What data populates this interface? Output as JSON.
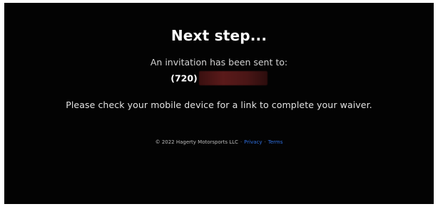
{
  "heading": "Next step...",
  "invite_text": "An invitation has been sent to:",
  "phone_prefix": "(720)",
  "instructions": "Please check your mobile device for a link to complete your waiver.",
  "footer": {
    "copyright": "© 2022 Hagerty Motorsports LLC",
    "separator": "·",
    "privacy_label": "Privacy",
    "terms_label": "Terms"
  },
  "colors": {
    "background": "#030303",
    "link": "#2f6fe0",
    "redaction": "#5a1a1a"
  }
}
